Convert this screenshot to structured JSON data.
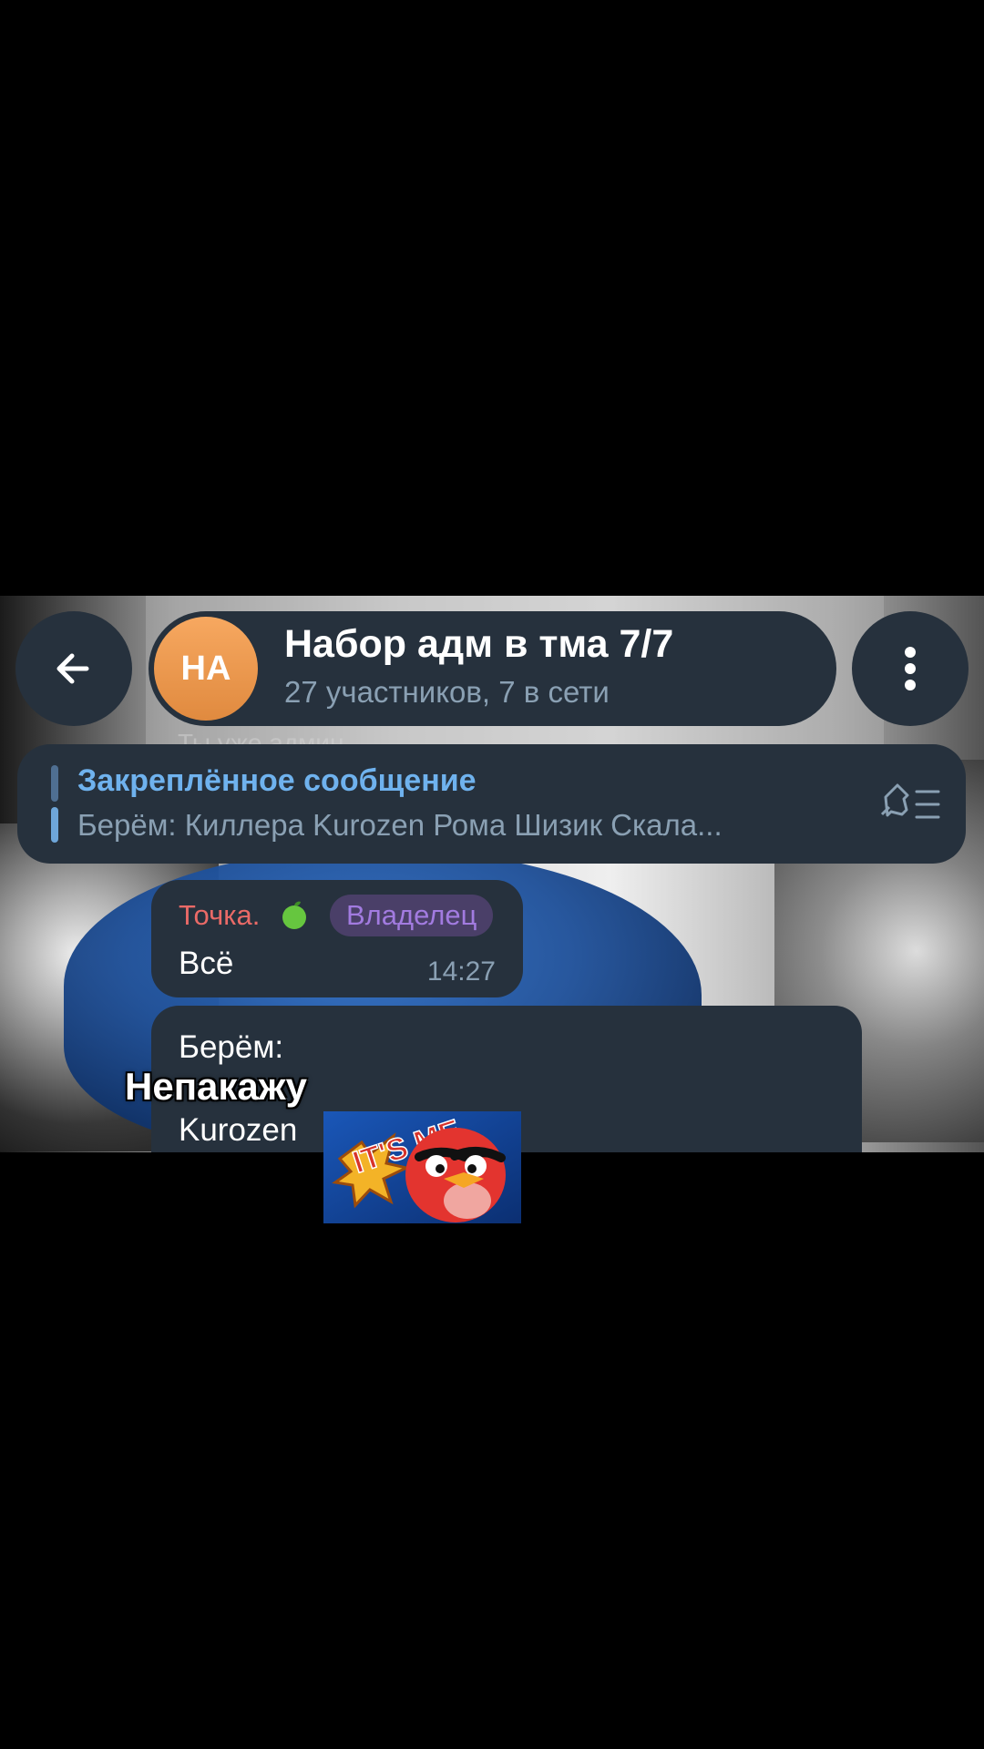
{
  "header": {
    "back_icon": "arrow-left-icon",
    "avatar_initials": "НА",
    "title": "Набор адм в тма 7/7",
    "subtitle": "27 участников, 7 в сети",
    "menu_icon": "more-vertical-icon"
  },
  "behind_header_text": "Ты уже админ",
  "pinned": {
    "title": "Закреплённое сообщение",
    "text": "Берём: Киллера Kurozen Рома Шизик  Скала...",
    "icon": "pin-list-icon"
  },
  "messages": [
    {
      "sender": "Точка.",
      "sender_emoji": "green-apple-emoji",
      "role": "Владелец",
      "text": "Всё",
      "time": "14:27"
    },
    {
      "lines": [
        "Берём:",
        "Kurozen"
      ]
    }
  ],
  "overlay_caption": "Непакажу",
  "sticker": {
    "text": "IT'S ME"
  },
  "colors": {
    "bubble": "#26313d",
    "accent": "#6fb2ee",
    "sender": "#ea6a67",
    "role_badge_bg": "#4a3f68",
    "role_badge_text": "#a27be0",
    "avatar": "#f09a4e"
  }
}
